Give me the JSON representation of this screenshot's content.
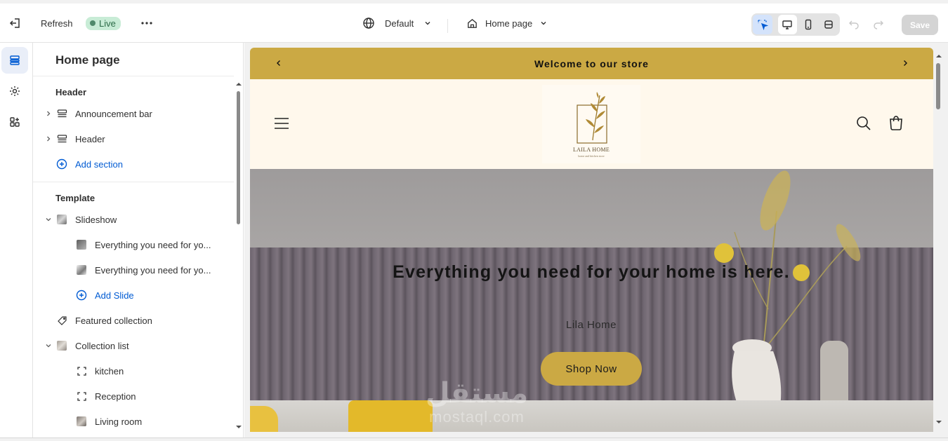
{
  "topbar": {
    "refresh_label": "Refresh",
    "live_label": "Live",
    "theme_label": "Default",
    "page_label": "Home page",
    "save_label": "Save"
  },
  "panel": {
    "title": "Home page",
    "header_group": {
      "title": "Header",
      "items": [
        {
          "label": "Announcement bar",
          "icon": "section-icon"
        },
        {
          "label": "Header",
          "icon": "section-icon"
        }
      ],
      "add_label": "Add section"
    },
    "template_group": {
      "title": "Template",
      "slideshow_label": "Slideshow",
      "slides": [
        {
          "label": "Everything you need for yo..."
        },
        {
          "label": "Everything you need for yo..."
        }
      ],
      "add_slide_label": "Add Slide",
      "featured_label": "Featured collection",
      "collection_list_label": "Collection list",
      "collections": [
        {
          "label": "kitchen",
          "icon": "placeholder-icon"
        },
        {
          "label": "Reception",
          "icon": "placeholder-icon"
        },
        {
          "label": "Living room",
          "icon": "thumbnail"
        }
      ]
    }
  },
  "preview": {
    "announcement": "Welcome to our store",
    "logo_name": "LAILA HOME",
    "logo_tagline": "home and kitchen store",
    "hero_title": "Everything you need for your home is here.",
    "hero_subtitle": "Lila Home",
    "hero_button": "Shop Now",
    "watermark_ar": "مستقل",
    "watermark_en": "mostaql.com"
  },
  "colors": {
    "accent_gold": "#cba944",
    "header_cream": "#fff8ec",
    "link_blue": "#005bd3",
    "live_green": "#c8ecd6"
  }
}
